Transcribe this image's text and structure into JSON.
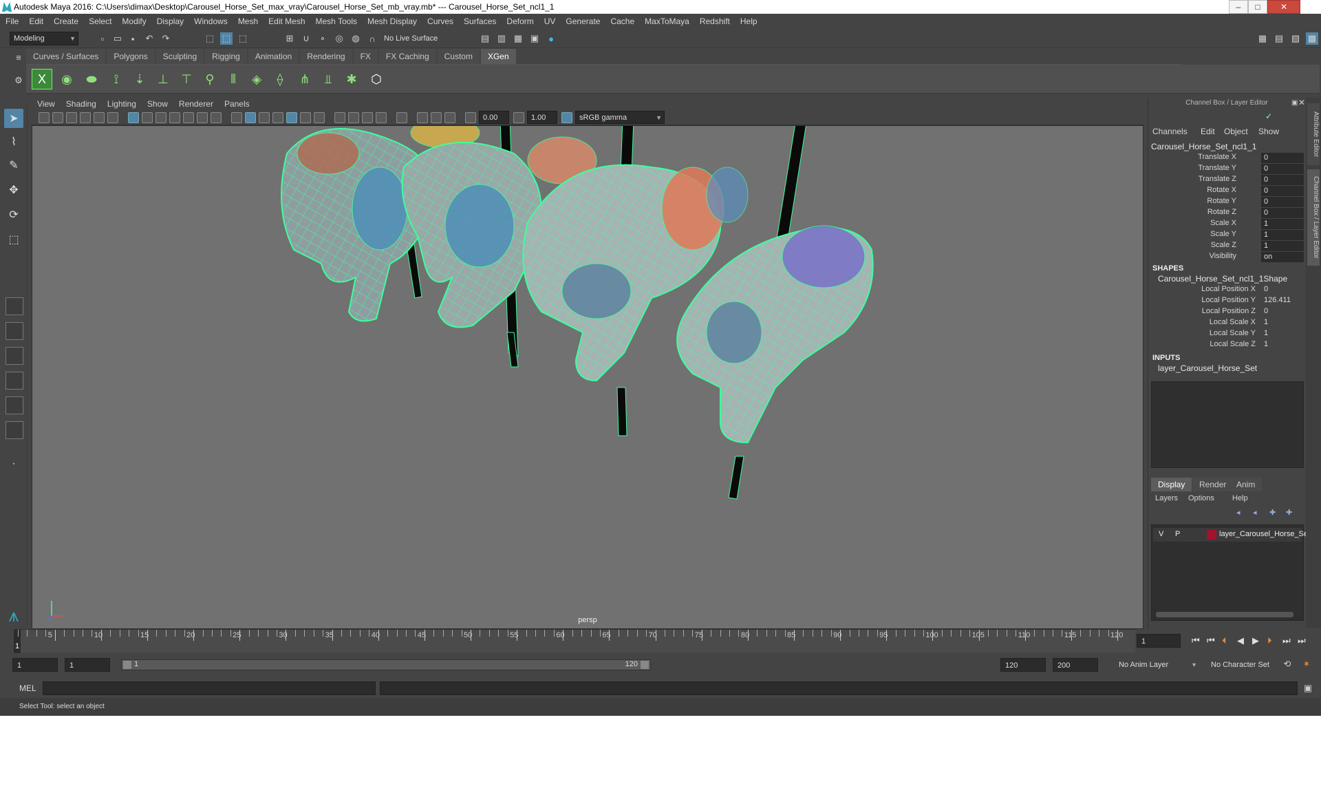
{
  "window": {
    "title": "Autodesk Maya 2016: C:\\Users\\dimax\\Desktop\\Carousel_Horse_Set_max_vray\\Carousel_Horse_Set_mb_vray.mb*   ---   Carousel_Horse_Set_ncl1_1",
    "min": "–",
    "max": "□",
    "close": "✕"
  },
  "menubar": [
    "File",
    "Edit",
    "Create",
    "Select",
    "Modify",
    "Display",
    "Windows",
    "Mesh",
    "Edit Mesh",
    "Mesh Tools",
    "Mesh Display",
    "Curves",
    "Surfaces",
    "Deform",
    "UV",
    "Generate",
    "Cache",
    "MaxToMaya",
    "Redshift",
    "Help"
  ],
  "status": {
    "mode": "Modeling",
    "live_surface": "No Live Surface"
  },
  "shelf": {
    "tabs": [
      "Curves / Surfaces",
      "Polygons",
      "Sculpting",
      "Rigging",
      "Animation",
      "Rendering",
      "FX",
      "FX Caching",
      "Custom",
      "XGen"
    ],
    "active": "XGen"
  },
  "viewport": {
    "menus": [
      "View",
      "Shading",
      "Lighting",
      "Show",
      "Renderer",
      "Panels"
    ],
    "exposure": "0.00",
    "gamma": "1.00",
    "colorspace": "sRGB gamma",
    "camera_label": "persp"
  },
  "channelbox": {
    "header": "Channel Box / Layer Editor",
    "menus": [
      "Channels",
      "Edit",
      "Object",
      "Show"
    ],
    "object": "Carousel_Horse_Set_ncl1_1",
    "channels": [
      {
        "label": "Translate X",
        "value": "0"
      },
      {
        "label": "Translate Y",
        "value": "0"
      },
      {
        "label": "Translate Z",
        "value": "0"
      },
      {
        "label": "Rotate X",
        "value": "0"
      },
      {
        "label": "Rotate Y",
        "value": "0"
      },
      {
        "label": "Rotate Z",
        "value": "0"
      },
      {
        "label": "Scale X",
        "value": "1"
      },
      {
        "label": "Scale Y",
        "value": "1"
      },
      {
        "label": "Scale Z",
        "value": "1"
      },
      {
        "label": "Visibility",
        "value": "on"
      }
    ],
    "shapes_title": "SHAPES",
    "shape_name": "Carousel_Horse_Set_ncl1_1Shape",
    "shape_attrs": [
      {
        "label": "Local Position X",
        "value": "0"
      },
      {
        "label": "Local Position Y",
        "value": "126.411"
      },
      {
        "label": "Local Position Z",
        "value": "0"
      },
      {
        "label": "Local Scale X",
        "value": "1"
      },
      {
        "label": "Local Scale Y",
        "value": "1"
      },
      {
        "label": "Local Scale Z",
        "value": "1"
      }
    ],
    "inputs_title": "INPUTS",
    "input_name": "layer_Carousel_Horse_Set"
  },
  "layers": {
    "tabs": [
      "Display",
      "Render",
      "Anim"
    ],
    "active_tab": "Display",
    "menus": [
      "Layers",
      "Options",
      "Help"
    ],
    "row": {
      "v": "V",
      "p": "P",
      "name": "layer_Carousel_Horse_Se",
      "color": "#a0142b"
    }
  },
  "side_tabs": [
    "Attribute Editor",
    "Channel Box / Layer Editor"
  ],
  "timeline": {
    "ticks": [
      5,
      10,
      15,
      20,
      25,
      30,
      35,
      40,
      45,
      50,
      55,
      60,
      65,
      70,
      75,
      80,
      85,
      90,
      95,
      100,
      105,
      110,
      115,
      120
    ],
    "current_frame": "1",
    "current_field": "1"
  },
  "range": {
    "start": "1",
    "start_inner": "1",
    "slider_start": "1",
    "slider_end": "120",
    "end_inner": "120",
    "end": "200",
    "anim_layer": "No Anim Layer",
    "char_set": "No Character Set"
  },
  "command": {
    "lang": "MEL"
  },
  "help": "Select Tool: select an object",
  "colors": {
    "wire": "#3dff9e",
    "select_accent": "#5285a6"
  }
}
